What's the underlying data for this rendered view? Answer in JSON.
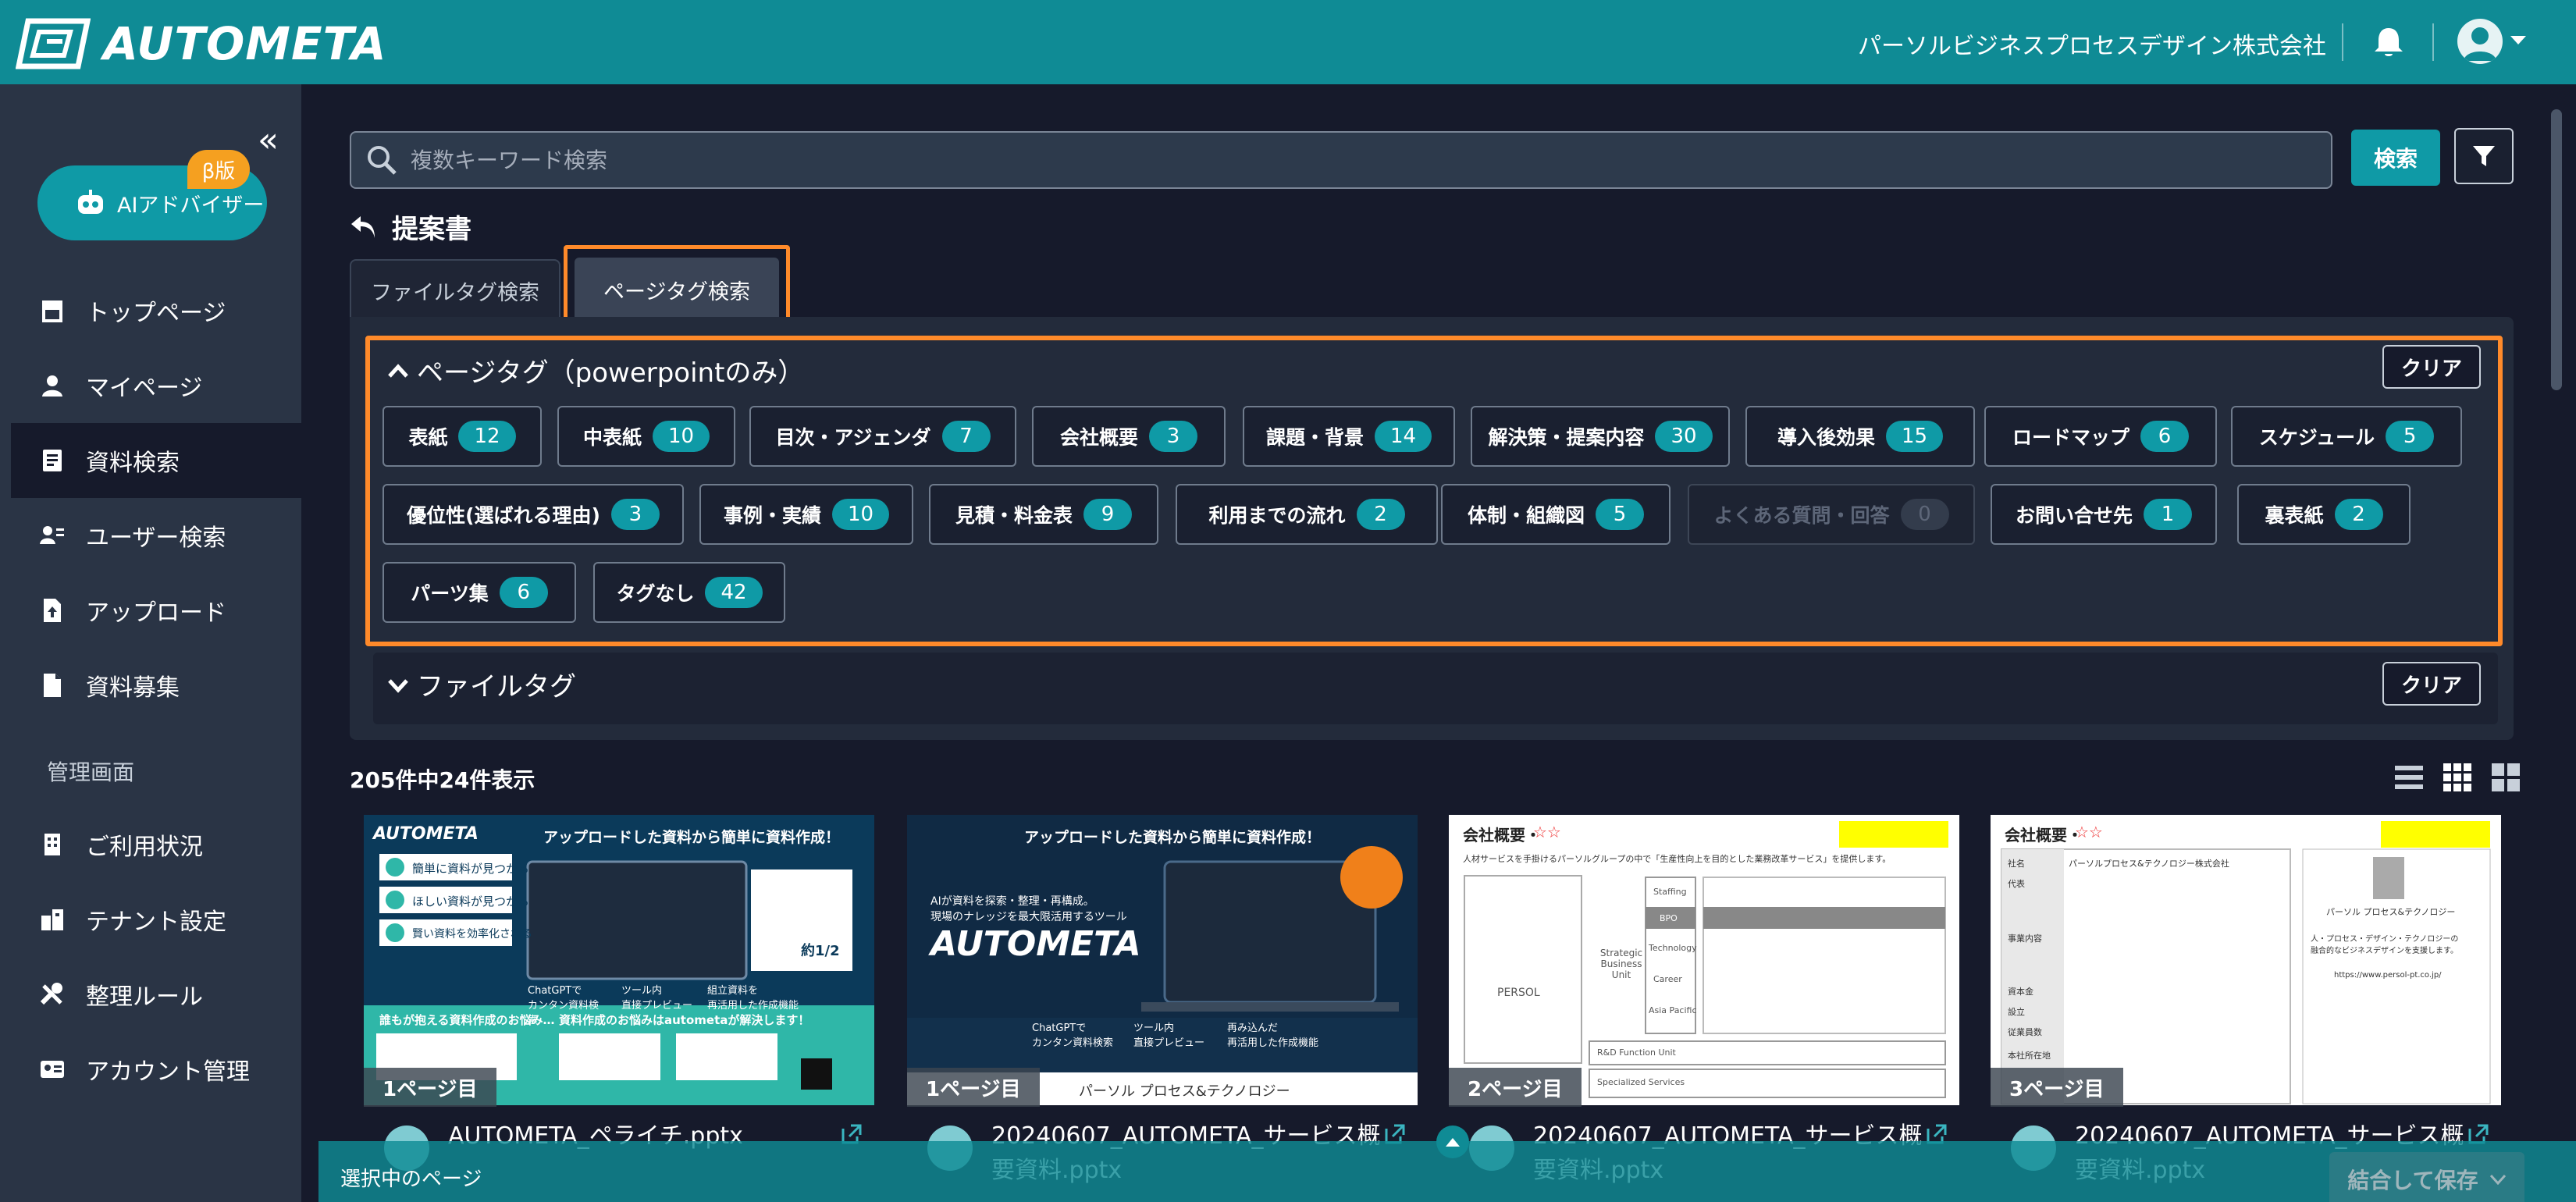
{
  "header": {
    "logo_text": "AUTOMETA",
    "company": "パーソルビジネスプロセスデザイン株式会社"
  },
  "sidebar": {
    "collapse_glyph": "«",
    "ai_label": "AIアドバイザー",
    "beta": "β版",
    "items": [
      {
        "label": "トップページ",
        "icon": "store-icon"
      },
      {
        "label": "マイページ",
        "icon": "user-icon"
      },
      {
        "label": "資料検索",
        "icon": "document-search-icon"
      },
      {
        "label": "ユーザー検索",
        "icon": "user-search-icon"
      },
      {
        "label": "アップロード",
        "icon": "file-upload-icon"
      },
      {
        "label": "資料募集",
        "icon": "file-icon"
      }
    ],
    "admin_header": "管理画面",
    "admin_items": [
      {
        "label": "ご利用状況",
        "icon": "building-icon"
      },
      {
        "label": "テナント設定",
        "icon": "tenant-icon"
      },
      {
        "label": "整理ルール",
        "icon": "tools-icon"
      },
      {
        "label": "アカウント管理",
        "icon": "id-card-icon"
      }
    ]
  },
  "search": {
    "placeholder": "複数キーワード検索",
    "button": "検索"
  },
  "page_title": "提案書",
  "tabs": [
    "ファイルタグ検索",
    "ページタグ検索"
  ],
  "page_tags": {
    "title": "ページタグ（powerpointのみ）",
    "clear": "クリア",
    "tags": [
      {
        "label": "表紙",
        "count": "12"
      },
      {
        "label": "中表紙",
        "count": "10"
      },
      {
        "label": "目次・アジェンダ",
        "count": "7"
      },
      {
        "label": "会社概要",
        "count": "3"
      },
      {
        "label": "課題・背景",
        "count": "14"
      },
      {
        "label": "解決策・提案内容",
        "count": "30"
      },
      {
        "label": "導入後効果",
        "count": "15"
      },
      {
        "label": "ロードマップ",
        "count": "6"
      },
      {
        "label": "スケジュール",
        "count": "5"
      },
      {
        "label": "優位性(選ばれる理由)",
        "count": "3"
      },
      {
        "label": "事例・実績",
        "count": "10"
      },
      {
        "label": "見積・料金表",
        "count": "9"
      },
      {
        "label": "利用までの流れ",
        "count": "2"
      },
      {
        "label": "体制・組織図",
        "count": "5"
      },
      {
        "label": "よくある質問・回答",
        "count": "0"
      },
      {
        "label": "お問い合せ先",
        "count": "1"
      },
      {
        "label": "裏表紙",
        "count": "2"
      },
      {
        "label": "パーツ集",
        "count": "6"
      },
      {
        "label": "タグなし",
        "count": "42"
      }
    ]
  },
  "file_tags": {
    "title": "ファイルタグ",
    "clear": "クリア"
  },
  "results": {
    "count_text": "205件中24件表示",
    "cards": [
      {
        "page": "1ページ目",
        "name": "AUTOMETA_ペライチ.pptx",
        "thumb": {
          "heading": "アップロードした資料から簡単に資料作成！",
          "brand": "AUTOMETA",
          "rows": [
            "簡単に資料が見つかる",
            "ほしい資料が見つかる",
            "賢い資料を効率化される"
          ],
          "chat": "ChatGPTで\nカンタン資料検索",
          "preview": "ツール内\n直接プレビュー",
          "merge": "組立資料を\n再活用した作成機能",
          "sub1": "誰もが抱える資料作成のお悩み…",
          "sub2": "資料作成のお悩みはautometaが解決します！",
          "badge": "約1/2"
        }
      },
      {
        "page": "1ページ目",
        "name": "20240607_AUTOMETA_サービス概要資料.pptx",
        "thumb": {
          "heading": "アップロードした資料から簡単に資料作成！",
          "brand": "AUTOMETA",
          "tagline": "AIが資料を探索・整理・再構成。\n現場のナレッジを最大限活用するツール",
          "chat": "ChatGPTで\nカンタン資料検索",
          "preview": "ツール内\n直接プレビュー",
          "merge": "再み込んだ\n再活用した作成機能",
          "footer": "パーソル プロセス&テクノロジー"
        }
      },
      {
        "page": "2ページ目",
        "name": "20240607_AUTOMETA_サービス概要資料.pptx",
        "thumb": {
          "title": "会社概要・",
          "stars": "☆☆",
          "note": "人材サービスを手掛けるパーソルグループの中で「生産性向上を目的とした業務改革サービス」を提供します。",
          "org": "PERSOL",
          "units": [
            "Staffing",
            "BPO",
            "Technology",
            "Career",
            "Asia Pacific",
            "R&D Function Unit",
            "Specialized Services"
          ],
          "sbu": "Strategic\nBusiness\nUnit"
        }
      },
      {
        "page": "3ページ目",
        "name": "20240607_AUTOMETA_サービス概要資料.pptx",
        "thumb": {
          "title": "会社概要・",
          "stars": "☆☆",
          "rows": [
            "社名",
            "代表",
            "事業内容",
            "資本金",
            "設立",
            "従業員数",
            "本社所在地"
          ],
          "company_name": "パーソルプロセス&テクノロジー株式会社",
          "brand": "パーソル プロセス&テクノロジー",
          "slogan": "人・プロセス・デザイン・テクノロジーの\n融合的なビジネスデザインを支援します。",
          "url": "https://www.persol-pt.co.jp/"
        }
      }
    ]
  },
  "selection": {
    "label": "選択中のページ",
    "merge_button": "結合して保存"
  },
  "colors": {
    "accent": "#0f9aa6",
    "header": "#0f8b95",
    "highlight": "#ff8a2a",
    "background": "#161a2b",
    "sidebar": "#2a3445"
  }
}
